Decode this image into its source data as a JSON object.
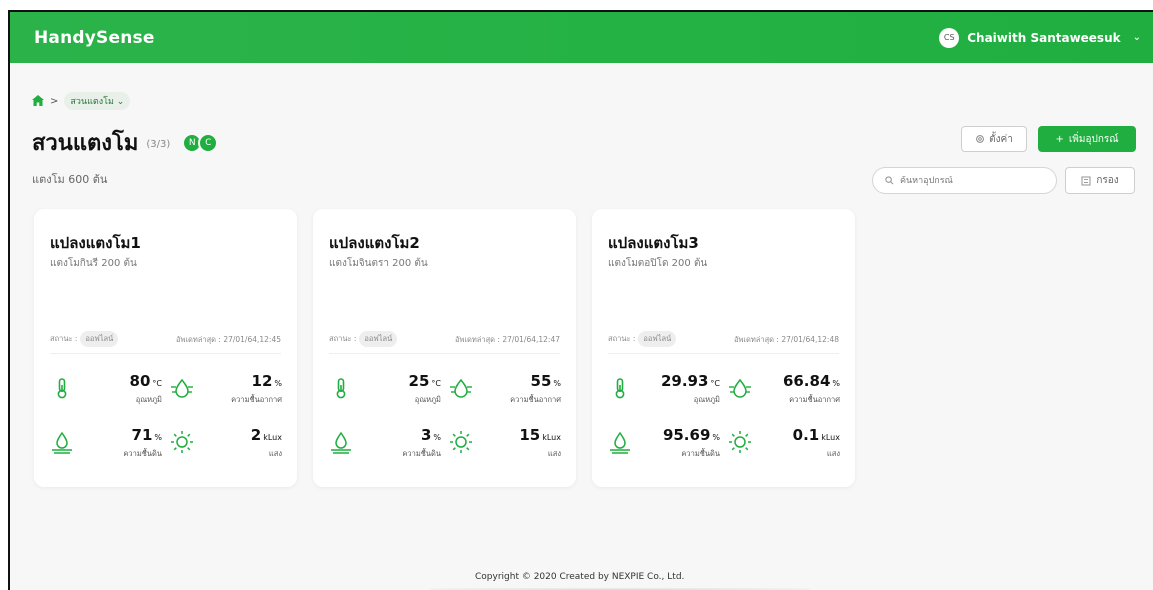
{
  "app": {
    "brand": "HandySense"
  },
  "user": {
    "initials": "CS",
    "name": "Chaiwith Santaweesuk"
  },
  "breadcrumb": {
    "current": "สวนแตงโม"
  },
  "page": {
    "title": "สวนแตงโม",
    "count": "(3/3)",
    "status_dots": [
      "N",
      "C"
    ],
    "subtitle": "แตงโม 600 ต้น"
  },
  "toolbar": {
    "settings_label": "ตั้งค่า",
    "add_label": "เพิ่มอุปกรณ์",
    "search_placeholder": "ค้นหาอุปกรณ์",
    "filter_label": "กรอง"
  },
  "colors": {
    "accent": "#1fae3f",
    "accent_dark": "#179435"
  },
  "devices": [
    {
      "title": "แปลงแตงโม1",
      "subtitle": "แตงโมกินรี 200 ต้น",
      "status_label": "สถานะ :",
      "status": "ออฟไลน์",
      "updated": "อัพเดทล่าสุด : 27/01/64,12:45",
      "temp": {
        "value": "80",
        "unit": "°C",
        "label": "อุณหภูมิ",
        "icon": "thermometer-icon"
      },
      "humidity": {
        "value": "12",
        "unit": "%",
        "label": "ความชื้นอากาศ",
        "icon": "air-humidity-icon"
      },
      "soil": {
        "value": "71",
        "unit": "%",
        "label": "ความชื้นดิน",
        "icon": "soil-moisture-icon"
      },
      "light": {
        "value": "2",
        "unit": "kLux",
        "label": "แสง",
        "icon": "sun-icon"
      }
    },
    {
      "title": "แปลงแตงโม2",
      "subtitle": "แตงโมจินตรา 200 ต้น",
      "status_label": "สถานะ :",
      "status": "ออฟไลน์",
      "updated": "อัพเดทล่าสุด : 27/01/64,12:47",
      "temp": {
        "value": "25",
        "unit": "°C",
        "label": "อุณหภูมิ",
        "icon": "thermometer-icon"
      },
      "humidity": {
        "value": "55",
        "unit": "%",
        "label": "ความชื้นอากาศ",
        "icon": "air-humidity-icon"
      },
      "soil": {
        "value": "3",
        "unit": "%",
        "label": "ความชื้นดิน",
        "icon": "soil-moisture-icon"
      },
      "light": {
        "value": "15",
        "unit": "kLux",
        "label": "แสง",
        "icon": "sun-icon"
      }
    },
    {
      "title": "แปลงแตงโม3",
      "subtitle": "แตงโมตอปิโด 200 ต้น",
      "status_label": "สถานะ :",
      "status": "ออฟไลน์",
      "updated": "อัพเดทล่าสุด : 27/01/64,12:48",
      "temp": {
        "value": "29.93",
        "unit": "°C",
        "label": "อุณหภูมิ",
        "icon": "thermometer-icon"
      },
      "humidity": {
        "value": "66.84",
        "unit": "%",
        "label": "ความชื้นอากาศ",
        "icon": "air-humidity-icon"
      },
      "soil": {
        "value": "95.69",
        "unit": "%",
        "label": "ความชื้นดิน",
        "icon": "soil-moisture-icon"
      },
      "light": {
        "value": "0.1",
        "unit": "kLux",
        "label": "แสง",
        "icon": "sun-icon"
      }
    }
  ],
  "footer": {
    "text": "Copyright © 2020 Created by NEXPIE Co., Ltd."
  }
}
